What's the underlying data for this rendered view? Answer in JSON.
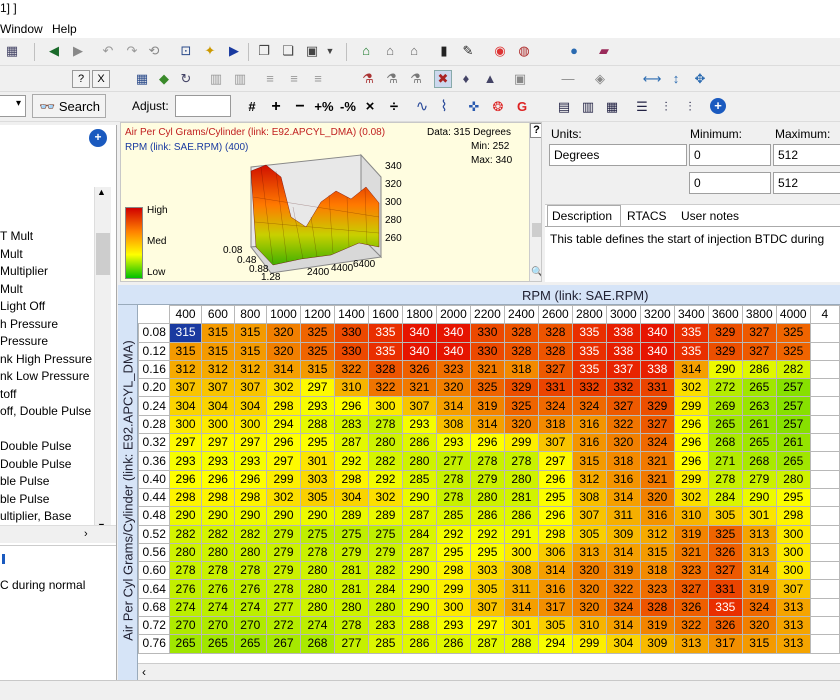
{
  "window": {
    "title": "1] ]"
  },
  "menu": [
    "Window",
    "Help"
  ],
  "left": {
    "search_label": "Search",
    "items": [
      "T Mult",
      "Mult",
      "Multiplier",
      "Mult",
      "Light Off",
      "h Pressure",
      "Pressure",
      "nk High Pressure",
      "nk Low Pressure",
      "toff",
      "off, Double Pulse",
      "",
      "Double Pulse",
      "Double Pulse",
      "ble Pulse",
      "ble Pulse",
      "ultiplier, Base"
    ],
    "desc_text": "C during normal",
    "close_label": "X",
    "help_label": "?"
  },
  "adjust": {
    "label": "Adjust:",
    "value": ""
  },
  "info": {
    "title": "Air Per Cyl Grams/Cylinder (link: E92.APCYL_DMA) (0.08)",
    "subtitle": "RPM (link: SAE.RPM) (400)",
    "data_label": "Data: 315 Degrees",
    "min_label": "Min: 252",
    "max_label": "Max: 340",
    "legend_high": "High",
    "legend_med": "Med",
    "legend_low": "Low",
    "z_ticks": [
      "340",
      "320",
      "300",
      "280",
      "260"
    ],
    "x_ticks": [
      "0.08",
      "0.48",
      "0.88",
      "1.28"
    ],
    "y_ticks": [
      "2400",
      "4400",
      "6400"
    ],
    "help_label": "?"
  },
  "props": {
    "units_label": "Units:",
    "min_label": "Minimum:",
    "max_label": "Maximum:",
    "units_value": "Degrees",
    "min_value": "0",
    "max_value": "512",
    "min_value2": "0",
    "max_value2": "512",
    "tabs": [
      "Description",
      "RTACS",
      "User notes"
    ],
    "description": "This table defines the start of injection BTDC during"
  },
  "grid": {
    "x_axis_label": "RPM (link: SAE.RPM)",
    "y_axis_label": "Air Per Cyl Grams/Cylinder (link: E92.APCYL_DMA)",
    "cols": [
      "400",
      "600",
      "800",
      "1000",
      "1200",
      "1400",
      "1600",
      "1800",
      "2000",
      "2200",
      "2400",
      "2600",
      "2800",
      "3000",
      "3200",
      "3400",
      "3600",
      "3800",
      "4000",
      "4"
    ],
    "rows": [
      "0.08",
      "0.12",
      "0.16",
      "0.20",
      "0.24",
      "0.28",
      "0.32",
      "0.36",
      "0.40",
      "0.44",
      "0.48",
      "0.52",
      "0.56",
      "0.60",
      "0.64",
      "0.68",
      "0.72",
      "0.76"
    ],
    "values": [
      [
        315,
        315,
        315,
        320,
        325,
        330,
        335,
        340,
        340,
        330,
        328,
        328,
        335,
        338,
        340,
        335,
        329,
        327,
        325,
        ""
      ],
      [
        315,
        315,
        315,
        320,
        325,
        330,
        335,
        340,
        340,
        330,
        328,
        328,
        335,
        338,
        340,
        335,
        329,
        327,
        325,
        ""
      ],
      [
        312,
        312,
        312,
        314,
        315,
        322,
        328,
        326,
        323,
        321,
        318,
        327,
        335,
        337,
        338,
        314,
        290,
        286,
        282,
        ""
      ],
      [
        307,
        307,
        307,
        302,
        297,
        310,
        322,
        321,
        320,
        325,
        329,
        331,
        332,
        332,
        331,
        302,
        272,
        265,
        257,
        ""
      ],
      [
        304,
        304,
        304,
        298,
        293,
        296,
        300,
        307,
        314,
        319,
        325,
        324,
        324,
        327,
        329,
        299,
        269,
        263,
        257,
        ""
      ],
      [
        300,
        300,
        300,
        294,
        288,
        283,
        278,
        293,
        308,
        314,
        320,
        318,
        316,
        322,
        327,
        296,
        265,
        261,
        257,
        ""
      ],
      [
        297,
        297,
        297,
        296,
        295,
        287,
        280,
        286,
        293,
        296,
        299,
        307,
        316,
        320,
        324,
        296,
        268,
        265,
        261,
        ""
      ],
      [
        293,
        293,
        293,
        297,
        301,
        292,
        282,
        280,
        277,
        278,
        278,
        297,
        315,
        318,
        321,
        296,
        271,
        268,
        265,
        ""
      ],
      [
        296,
        296,
        296,
        299,
        303,
        298,
        292,
        285,
        278,
        279,
        280,
        296,
        312,
        316,
        321,
        299,
        278,
        279,
        280,
        ""
      ],
      [
        298,
        298,
        298,
        302,
        305,
        304,
        302,
        290,
        278,
        280,
        281,
        295,
        308,
        314,
        320,
        302,
        284,
        290,
        295,
        ""
      ],
      [
        290,
        290,
        290,
        290,
        290,
        289,
        289,
        287,
        285,
        286,
        286,
        296,
        307,
        311,
        316,
        310,
        305,
        301,
        298,
        ""
      ],
      [
        282,
        282,
        282,
        279,
        275,
        275,
        275,
        284,
        292,
        292,
        291,
        298,
        305,
        309,
        312,
        319,
        325,
        313,
        300,
        ""
      ],
      [
        280,
        280,
        280,
        279,
        278,
        279,
        279,
        287,
        295,
        295,
        300,
        306,
        313,
        314,
        315,
        321,
        326,
        313,
        300,
        ""
      ],
      [
        278,
        278,
        278,
        279,
        280,
        281,
        282,
        290,
        298,
        303,
        308,
        314,
        320,
        319,
        318,
        323,
        327,
        314,
        300,
        ""
      ],
      [
        276,
        276,
        276,
        278,
        280,
        281,
        284,
        290,
        299,
        305,
        311,
        316,
        320,
        322,
        323,
        327,
        331,
        319,
        307,
        ""
      ],
      [
        274,
        274,
        274,
        277,
        280,
        280,
        280,
        290,
        300,
        307,
        314,
        317,
        320,
        324,
        328,
        326,
        335,
        324,
        313,
        ""
      ],
      [
        270,
        270,
        270,
        272,
        274,
        278,
        283,
        288,
        293,
        297,
        301,
        305,
        310,
        314,
        319,
        322,
        326,
        320,
        313,
        ""
      ],
      [
        265,
        265,
        265,
        267,
        268,
        277,
        285,
        286,
        286,
        287,
        288,
        294,
        299,
        304,
        309,
        313,
        317,
        315,
        313,
        ""
      ]
    ]
  }
}
